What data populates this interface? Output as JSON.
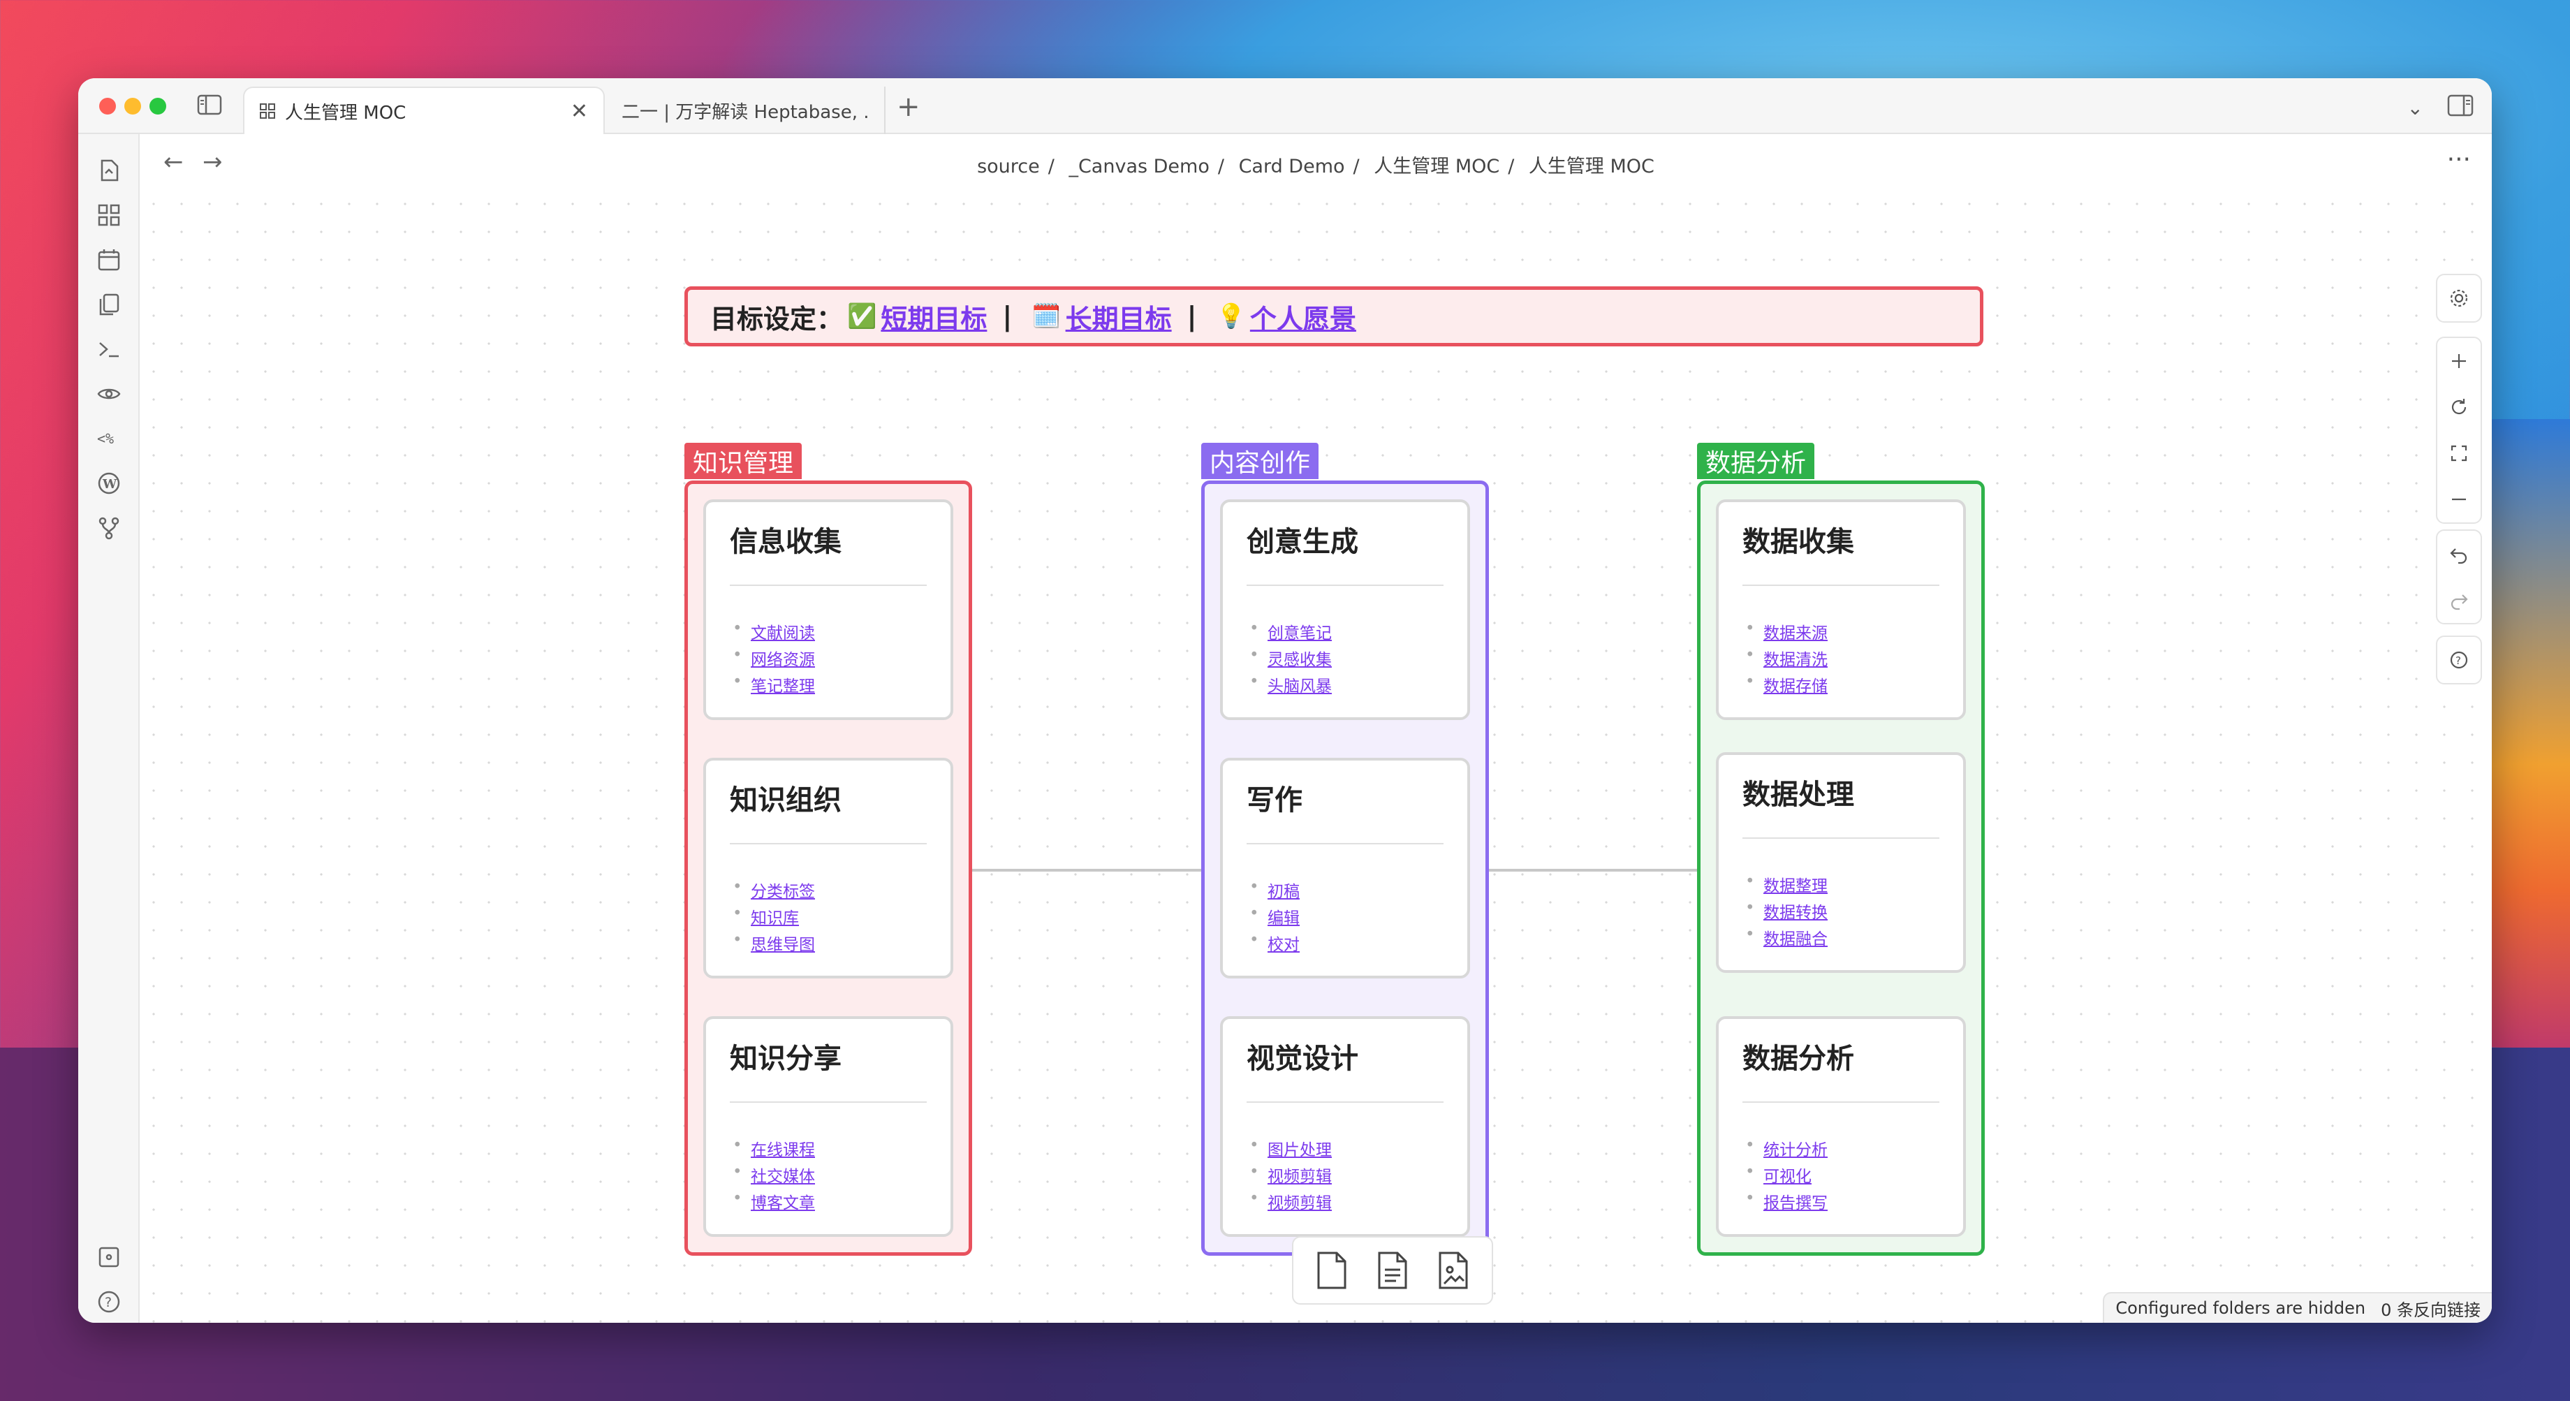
{
  "tabs": [
    {
      "label": "人生管理 MOC",
      "close": "✕"
    },
    {
      "label": "二一 | 万字解读 Heptabase, ..."
    }
  ],
  "new_tab": "+",
  "breadcrumb": [
    "source",
    "_Canvas Demo",
    "Card Demo",
    "人生管理 MOC",
    "人生管理 MOC"
  ],
  "breadcrumb_sep": "/",
  "nav": {
    "back": "←",
    "forward": "→",
    "more": "···"
  },
  "goal_bar": {
    "prefix": "目标设定：",
    "items": [
      {
        "emoji": "✅",
        "label": "短期目标"
      },
      {
        "emoji": "🗓️",
        "label": "长期目标"
      },
      {
        "emoji": "💡",
        "label": "个人愿景"
      }
    ],
    "separator": "|"
  },
  "groups": [
    {
      "label": "知识管理",
      "color": "#e8515d",
      "bg": "#fdeced",
      "cards": [
        {
          "title": "信息收集",
          "items": [
            "文献阅读",
            "网络资源",
            "笔记整理"
          ]
        },
        {
          "title": "知识组织",
          "items": [
            "分类标签",
            "知识库",
            "思维导图"
          ]
        },
        {
          "title": "知识分享",
          "items": [
            "在线课程",
            "社交媒体",
            "博客文章"
          ]
        }
      ]
    },
    {
      "label": "内容创作",
      "color": "#8b6cf0",
      "bg": "#f3effd",
      "cards": [
        {
          "title": "创意生成",
          "items": [
            "创意笔记",
            "灵感收集",
            "头脑风暴"
          ]
        },
        {
          "title": "写作",
          "items": [
            "初稿",
            "编辑",
            "校对"
          ]
        },
        {
          "title": "视觉设计",
          "items": [
            "图片处理",
            "视频剪辑",
            "视频剪辑"
          ]
        }
      ]
    },
    {
      "label": "数据分析",
      "color": "#2fb24a",
      "bg": "#edf8ee",
      "cards": [
        {
          "title": "数据收集",
          "items": [
            "数据来源",
            "数据清洗",
            "数据存储"
          ]
        },
        {
          "title": "数据处理",
          "items": [
            "数据整理",
            "数据转换",
            "数据融合"
          ]
        },
        {
          "title": "数据分析",
          "items": [
            "统计分析",
            "可视化",
            "报告撰写"
          ]
        }
      ]
    }
  ],
  "status": {
    "hidden": "Configured folders are hidden",
    "backlinks": "0 条反向链接"
  }
}
